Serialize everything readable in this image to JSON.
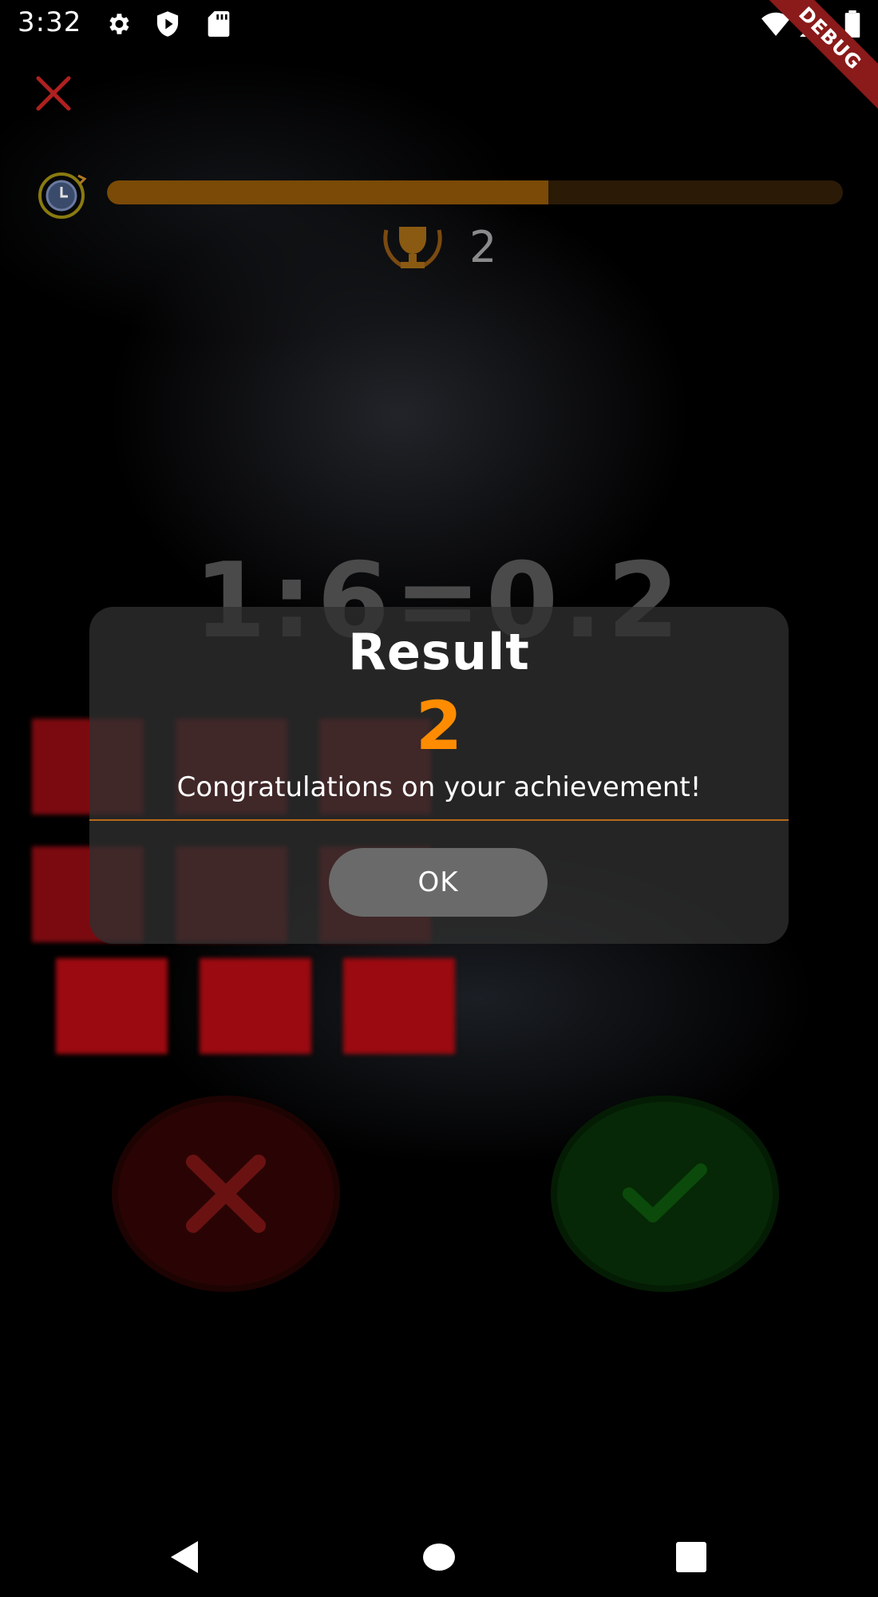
{
  "status_bar": {
    "time": "3:32",
    "icons": [
      "gear-icon",
      "play-protect-icon",
      "sd-card-icon",
      "wifi-icon",
      "signal-icon",
      "battery-icon"
    ],
    "debug_label": "DEBUG"
  },
  "top_bar": {
    "close_icon": "close-icon",
    "timer_icon": "timer-icon",
    "progress": 0.6,
    "score": "2"
  },
  "game": {
    "equation": "1:6=0.2",
    "wrong_icon": "x-icon",
    "right_icon": "check-icon"
  },
  "dialog": {
    "title": "Result",
    "value": "2",
    "message": "Congratulations on your achievement!",
    "ok_label": "OK"
  },
  "nav_bar": {
    "icons": [
      "back-icon",
      "home-icon",
      "recents-icon"
    ]
  },
  "colors": {
    "accent_orange": "#ff8c00",
    "wrong_red": "#c62828",
    "right_green": "#1b8f1b"
  }
}
